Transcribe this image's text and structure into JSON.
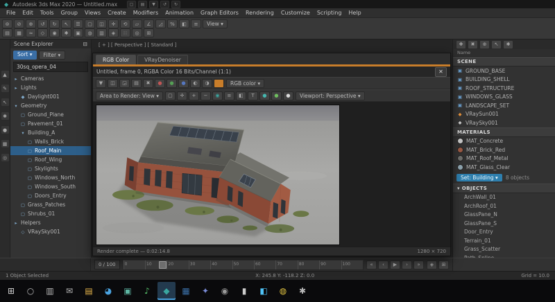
{
  "colors": {
    "accent_orange": "#c87d2a",
    "selection_blue": "#2d5f8a",
    "taskbar_active_blue": "#4aa3e0"
  },
  "titlebar": {
    "app_icon": "◆",
    "title": "Autodesk 3ds Max 2020 — Untitled.max",
    "quick_icons": [
      {
        "name": "new-scene-icon",
        "glyph": "▢"
      },
      {
        "name": "open-file-icon",
        "glyph": "▤"
      },
      {
        "name": "save-icon",
        "glyph": "▼"
      },
      {
        "name": "undo-icon",
        "glyph": "↺"
      },
      {
        "name": "redo-icon",
        "glyph": "↻"
      }
    ]
  },
  "menubar": {
    "items": [
      "File",
      "Edit",
      "Tools",
      "Group",
      "Views",
      "Create",
      "Modifiers",
      "Animation",
      "Graph Editors",
      "Rendering",
      "Customize",
      "Scripting",
      "Help"
    ]
  },
  "toolbar": {
    "coord_dropdown": "View ▾",
    "row1": [
      {
        "name": "select-link-icon",
        "glyph": "⊚"
      },
      {
        "name": "unlink-icon",
        "glyph": "⊘"
      },
      {
        "name": "bind-spacewarp-icon",
        "glyph": "⊕"
      },
      {
        "name": "undo-icon",
        "glyph": "↺"
      },
      {
        "name": "redo-icon",
        "glyph": "↻"
      },
      {
        "name": "select-object-icon",
        "glyph": "↖"
      },
      {
        "name": "select-by-name-icon",
        "glyph": "☰"
      },
      {
        "name": "selection-region-icon",
        "glyph": "▢"
      },
      {
        "name": "window-crossing-icon",
        "glyph": "◫"
      },
      {
        "name": "select-move-icon",
        "glyph": "✛"
      },
      {
        "name": "select-rotate-icon",
        "glyph": "⟲"
      },
      {
        "name": "select-scale-icon",
        "glyph": "▱"
      },
      {
        "name": "snap-toggle-icon",
        "glyph": "∠"
      },
      {
        "name": "angle-snap-icon",
        "glyph": "◿"
      },
      {
        "name": "percent-snap-icon",
        "glyph": "%"
      },
      {
        "name": "mirror-icon",
        "glyph": "◧"
      },
      {
        "name": "align-icon",
        "glyph": "≡"
      }
    ],
    "row2": [
      {
        "name": "layer-manager-icon",
        "glyph": "▤"
      },
      {
        "name": "ribbon-icon",
        "glyph": "▦"
      },
      {
        "name": "curve-editor-icon",
        "glyph": "≈"
      },
      {
        "name": "schematic-view-icon",
        "glyph": "◇"
      },
      {
        "name": "material-editor-icon",
        "glyph": "◉"
      },
      {
        "name": "render-setup-icon",
        "glyph": "✱"
      },
      {
        "name": "rendered-frame-icon",
        "glyph": "▣"
      },
      {
        "name": "render-production-icon",
        "glyph": "◍"
      },
      {
        "name": "scene-explorer-icon",
        "glyph": "▥"
      },
      {
        "name": "named-sets-icon",
        "glyph": "◈"
      },
      {
        "name": "array-icon",
        "glyph": "∷"
      },
      {
        "name": "isolate-icon",
        "glyph": "◎"
      },
      {
        "name": "viewport-config-icon",
        "glyph": "⊞"
      }
    ]
  },
  "left_dock": {
    "items": [
      {
        "name": "modeling-icon",
        "glyph": "▲"
      },
      {
        "name": "freeform-icon",
        "glyph": "✎"
      },
      {
        "name": "selection-icon",
        "glyph": "↖"
      },
      {
        "name": "object-paint-icon",
        "glyph": "✱"
      },
      {
        "name": "populate-icon",
        "glyph": "●"
      },
      {
        "name": "layout-icon",
        "glyph": "▦"
      },
      {
        "name": "isolate-view-icon",
        "glyph": "◎"
      }
    ]
  },
  "scene_explorer": {
    "title": "Scene Explorer",
    "pin_icon": "⊟",
    "sort_button": "Sort ▾",
    "filter_button": "Filter ▾",
    "search_value": "30sq_opera_04",
    "items": [
      {
        "icon": "▸",
        "label": "Cameras",
        "pad": "4px"
      },
      {
        "icon": "▸",
        "label": "Lights",
        "pad": "4px"
      },
      {
        "icon": "◆",
        "label": "Daylight001",
        "pad": "14px"
      },
      {
        "icon": "▾",
        "label": "Geometry",
        "pad": "4px"
      },
      {
        "icon": "▢",
        "label": "Ground_Plane",
        "pad": "14px"
      },
      {
        "icon": "▢",
        "label": "Pavement_01",
        "pad": "14px"
      },
      {
        "icon": "▾",
        "label": "Building_A",
        "pad": "14px"
      },
      {
        "icon": "▢",
        "label": "Walls_Brick",
        "pad": "24px"
      },
      {
        "icon": "▢",
        "label": "Roof_Main",
        "pad": "24px",
        "selected": true
      },
      {
        "icon": "▢",
        "label": "Roof_Wing",
        "pad": "24px"
      },
      {
        "icon": "▢",
        "label": "Skylights",
        "pad": "24px"
      },
      {
        "icon": "▢",
        "label": "Windows_North",
        "pad": "24px"
      },
      {
        "icon": "▢",
        "label": "Windows_South",
        "pad": "24px"
      },
      {
        "icon": "▢",
        "label": "Doors_Entry",
        "pad": "24px"
      },
      {
        "icon": "▢",
        "label": "Grass_Patches",
        "pad": "14px"
      },
      {
        "icon": "▢",
        "label": "Shrubs_01",
        "pad": "14px"
      },
      {
        "icon": "▸",
        "label": "Helpers",
        "pad": "4px"
      },
      {
        "icon": "◇",
        "label": "VRaySky001",
        "pad": "14px"
      }
    ]
  },
  "viewport_label": "[ + ]  [ Perspective ]  [ Standard ]",
  "render_window": {
    "tabs": [
      {
        "label": "RGB Color",
        "active": true
      },
      {
        "label": "VRayDenoiser"
      }
    ],
    "progress_percent": 100,
    "title": "Untitled, frame 0, RGBA Color 16 Bits/Channel (1:1)",
    "close_icon": "✕",
    "channel_dropdown": "RGB color ▾",
    "area_dropdown": "Area to Render: View ▾",
    "viewport_dropdown": "Viewport: Perspective ▾",
    "toolbar_a": [
      {
        "name": "save-image-icon",
        "glyph": "▼"
      },
      {
        "name": "copy-image-icon",
        "glyph": "◫"
      },
      {
        "name": "clone-window-icon",
        "glyph": "◲"
      },
      {
        "name": "print-image-icon",
        "glyph": "▤"
      },
      {
        "name": "clear-image-icon",
        "glyph": "✖"
      },
      {
        "name": "red-channel-icon",
        "glyph": "●",
        "color": "#c05555"
      },
      {
        "name": "green-channel-icon",
        "glyph": "●",
        "color": "#55a055"
      },
      {
        "name": "blue-channel-icon",
        "glyph": "●",
        "color": "#5577c0"
      },
      {
        "name": "alpha-channel-icon",
        "glyph": "◐"
      },
      {
        "name": "monochrome-icon",
        "glyph": "◑"
      },
      {
        "name": "background-color-swatch",
        "glyph": "",
        "bg": "#c87d2a"
      }
    ],
    "toolbar_b": [
      {
        "name": "region-render-icon",
        "glyph": "▢"
      },
      {
        "name": "pan-image-icon",
        "glyph": "✛"
      },
      {
        "name": "zoom-in-icon",
        "glyph": "+"
      },
      {
        "name": "zoom-out-icon",
        "glyph": "−"
      },
      {
        "name": "track-mouse-icon",
        "glyph": "◉",
        "color": "#3aa7a0"
      },
      {
        "name": "history-icon",
        "glyph": "≡"
      },
      {
        "name": "compare-icon",
        "glyph": "◧"
      },
      {
        "name": "stamp-icon",
        "glyph": "T"
      },
      {
        "name": "status-dot-teal-icon",
        "glyph": "●",
        "color": "#45b8b0"
      },
      {
        "name": "status-dot-green-icon",
        "glyph": "●",
        "color": "#6fbf5f"
      },
      {
        "name": "status-dot-white-icon",
        "glyph": "●",
        "color": "#dddddd"
      }
    ],
    "status_left": "Render complete — 0:02:14.8",
    "status_right": "1280 × 720"
  },
  "right_panel": {
    "toolbar_icons": [
      {
        "name": "create-layer-icon",
        "glyph": "✚"
      },
      {
        "name": "delete-layer-icon",
        "glyph": "✖"
      },
      {
        "name": "add-to-layer-icon",
        "glyph": "⊕"
      },
      {
        "name": "pick-layer-icon",
        "glyph": "↖"
      },
      {
        "name": "panel-settings-icon",
        "glyph": "✱"
      }
    ],
    "column_header": "Name",
    "section_scene": "SCENE",
    "scene_rows": [
      {
        "icon": "▣",
        "label": "GROUND_BASE",
        "color": "#6fa7d8"
      },
      {
        "icon": "▣",
        "label": "BUILDING_SHELL",
        "color": "#6fa7d8"
      },
      {
        "icon": "▣",
        "label": "ROOF_STRUCTURE",
        "color": "#6fa7d8"
      },
      {
        "icon": "▣",
        "label": "WINDOWS_GLASS",
        "color": "#6fa7d8"
      },
      {
        "icon": "▣",
        "label": "LANDSCAPE_SET",
        "color": "#6fa7d8"
      },
      {
        "icon": "◆",
        "label": "VRaySun001",
        "color": "#e8923a"
      },
      {
        "icon": "◆",
        "label": "VRaySky001",
        "color": "#cccccc"
      }
    ],
    "section_materials": "MATERIALS",
    "material_rows": [
      {
        "dot": "#c9c9c9",
        "label": "MAT_Concrete"
      },
      {
        "dot": "#9c5a44",
        "label": "MAT_Brick_Red"
      },
      {
        "dot": "#6f6f6c",
        "label": "MAT_Roof_Metal"
      },
      {
        "dot": "#8fa5b0",
        "label": "MAT_Glass_Clear"
      }
    ],
    "set_dropdown": "Set: Building ▾",
    "set_count": "8 objects",
    "section_objects": "▾ OBJECTS",
    "object_rows": [
      {
        "label": "ArchWall_01"
      },
      {
        "label": "ArchRoof_01"
      },
      {
        "label": "GlassPane_N"
      },
      {
        "label": "GlassPane_S"
      },
      {
        "label": "Door_Entry"
      },
      {
        "label": "Terrain_01"
      },
      {
        "label": "Grass_Scatter"
      },
      {
        "label": "Path_Spline"
      }
    ]
  },
  "timeline": {
    "frame_label": "0 / 100",
    "ticks": [
      "0",
      "10",
      "20",
      "30",
      "40",
      "50",
      "60",
      "70",
      "80",
      "90",
      "100"
    ],
    "slider_left_percent": 15,
    "playback": [
      {
        "name": "go-to-start-icon",
        "glyph": "«"
      },
      {
        "name": "previous-frame-icon",
        "glyph": "‹"
      },
      {
        "name": "play-icon",
        "glyph": "▶"
      },
      {
        "name": "next-frame-icon",
        "glyph": "›"
      },
      {
        "name": "go-to-end-icon",
        "glyph": "»"
      }
    ],
    "extra": [
      {
        "name": "key-mode-icon",
        "glyph": "◈"
      },
      {
        "name": "time-configuration-icon",
        "glyph": "⊞"
      }
    ]
  },
  "statusbar": {
    "left": "1 Object Selected",
    "coords": "X: 245.8    Y: -118.2    Z: 0.0",
    "right": "Grid = 10.0"
  },
  "taskbar": {
    "items": [
      {
        "name": "start-button",
        "glyph": "⊞",
        "color": "#d8d8d8"
      },
      {
        "name": "search-icon",
        "glyph": "○",
        "color": "#bbbbbb"
      },
      {
        "name": "task-view-icon",
        "glyph": "▥",
        "color": "#bbbbbb"
      },
      {
        "name": "mail-icon",
        "glyph": "✉",
        "color": "#bbbbbb"
      },
      {
        "name": "file-explorer-icon",
        "glyph": "▤",
        "color": "#e8b64c"
      },
      {
        "name": "browser-icon",
        "glyph": "◕",
        "color": "#4aa3e0"
      },
      {
        "name": "photos-icon",
        "glyph": "▣",
        "color": "#5fb8a5"
      },
      {
        "name": "music-icon",
        "glyph": "♪",
        "color": "#57c26b"
      },
      {
        "name": "3ds-max-icon",
        "glyph": "◆",
        "color": "#3aa7a0",
        "active": true
      },
      {
        "name": "paint-app-icon",
        "glyph": "▦",
        "color": "#3a6ea5"
      },
      {
        "name": "chat-app-icon",
        "glyph": "✦",
        "color": "#7a8cd8"
      },
      {
        "name": "game-platform-icon",
        "glyph": "◉",
        "color": "#9a9a9a"
      },
      {
        "name": "terminal-icon",
        "glyph": "▮",
        "color": "#cccccc"
      },
      {
        "name": "code-editor-icon",
        "glyph": "◧",
        "color": "#4fc3f7"
      },
      {
        "name": "browser2-icon",
        "glyph": "◍",
        "color": "#e0c341"
      },
      {
        "name": "settings-icon",
        "glyph": "✱",
        "color": "#bbbbbb"
      }
    ]
  }
}
